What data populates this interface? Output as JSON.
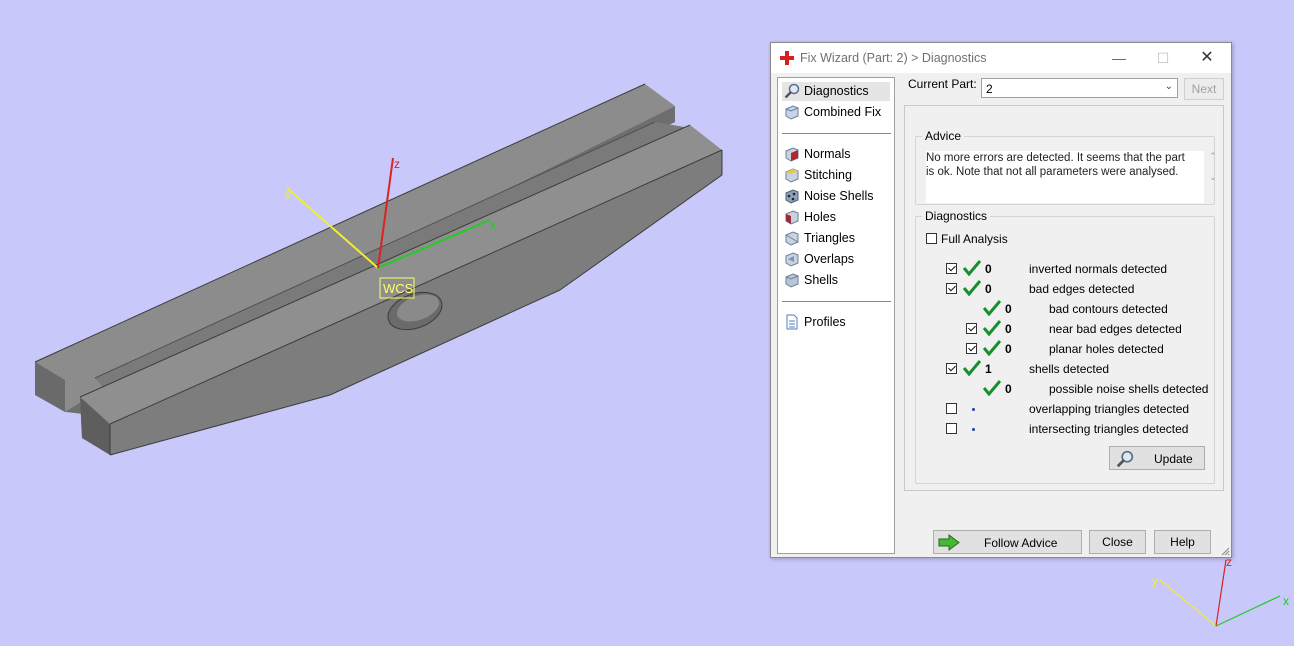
{
  "window": {
    "title": "Fix Wizard (Part: 2) > Diagnostics",
    "minimize_glyph": "—",
    "maximize_glyph": "☐",
    "close_glyph": "✕"
  },
  "viewport": {
    "wcs_label": "WCS",
    "axis_z": "z",
    "axis_x": "x",
    "axis_y": "y",
    "mini_axis_z": "z",
    "mini_axis_y": "y",
    "mini_axis_x": "x",
    "colors": {
      "background": "#c8c8fa",
      "x_axis": "#22cc22",
      "y_axis": "#eeee33",
      "z_axis": "#dd2222"
    }
  },
  "nav": {
    "items": [
      {
        "label": "Diagnostics",
        "icon": "magnifier-icon",
        "selected": true
      },
      {
        "label": "Combined Fix",
        "icon": "cube-icon"
      },
      {
        "label": "Normals",
        "icon": "normals-cube-icon"
      },
      {
        "label": "Stitching",
        "icon": "stitching-cube-icon"
      },
      {
        "label": "Noise Shells",
        "icon": "noise-shells-icon"
      },
      {
        "label": "Holes",
        "icon": "holes-cube-icon"
      },
      {
        "label": "Triangles",
        "icon": "triangles-cube-icon"
      },
      {
        "label": "Overlaps",
        "icon": "overlaps-cube-icon"
      },
      {
        "label": "Shells",
        "icon": "shells-cube-icon"
      },
      {
        "label": "Profiles",
        "icon": "document-icon"
      }
    ]
  },
  "current_part": {
    "label": "Current Part:",
    "value": "2",
    "next_label": "Next"
  },
  "advice": {
    "legend": "Advice",
    "line1": "No more errors are detected. It seems that the part",
    "line2": "is ok. Note that not all parameters were analysed."
  },
  "diagnostics": {
    "legend": "Diagnostics",
    "full_analysis_label": "Full Analysis",
    "full_analysis_checked": false,
    "rows": [
      {
        "checked": true,
        "status": "ok",
        "count": "0",
        "label": "inverted normals detected"
      },
      {
        "checked": true,
        "status": "ok",
        "count": "0",
        "label": "bad edges detected"
      },
      {
        "status": "ok",
        "count": "0",
        "label": "bad contours detected"
      },
      {
        "checked": true,
        "status": "ok",
        "count": "0",
        "label": "near bad edges detected"
      },
      {
        "checked": true,
        "status": "ok",
        "count": "0",
        "label": "planar holes detected"
      },
      {
        "checked": true,
        "status": "ok",
        "count": "1",
        "label": "shells detected"
      },
      {
        "status": "ok",
        "count": "0",
        "label": "possible noise shells detected"
      },
      {
        "checked": false,
        "status": "not-analysed",
        "label": "overlapping triangles detected"
      },
      {
        "checked": false,
        "status": "not-analysed",
        "label": "intersecting triangles detected"
      }
    ],
    "update_label": "Update"
  },
  "footer": {
    "follow_advice_label": "Follow Advice",
    "close_label": "Close",
    "help_label": "Help"
  }
}
